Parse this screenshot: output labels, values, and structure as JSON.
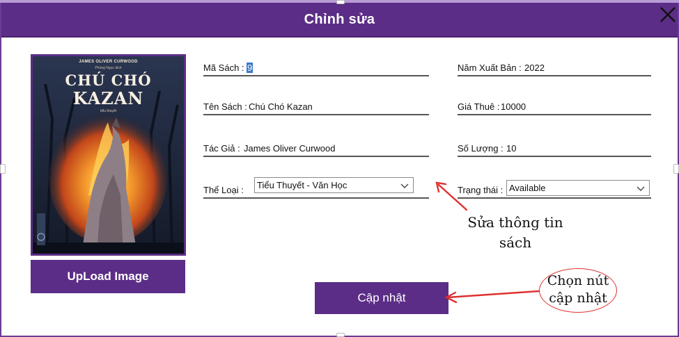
{
  "window": {
    "title": "Chỉnh sửa",
    "close_icon": "close-icon"
  },
  "cover": {
    "author_line": "JAMES OLIVER CURWOOD",
    "translator_line": "Phùng Ngọc dịch",
    "title_line1": "CHÚ CHÓ",
    "title_line2": "KAZAN",
    "subtitle": "tiểu thuyết"
  },
  "buttons": {
    "upload_label": "UpLoad Image",
    "update_label": "Cập nhật"
  },
  "fields": {
    "ma_sach": {
      "label": "Mã Sách :",
      "value": "9"
    },
    "ten_sach": {
      "label": "Tên Sách :",
      "value": "Chú Chó Kazan"
    },
    "tac_gia": {
      "label": "Tác Giả :",
      "value": "James Oliver Curwood"
    },
    "the_loai": {
      "label": "Thể  Loại :",
      "value": "Tiểu Thuyết - Văn Học"
    },
    "nam_xuat_ban": {
      "label": "Năm Xuất Bản :",
      "value": "2022"
    },
    "gia_thue": {
      "label": "Giá Thuê :",
      "value": "10000"
    },
    "so_luong": {
      "label": "Số Lượng :",
      "value": "10"
    },
    "trang_thai": {
      "label": "Trạng thái :",
      "value": "Available"
    }
  },
  "annotations": {
    "edit_line1": "Sửa thông tin",
    "edit_line2": "sách",
    "choose_line1": "Chọn nút",
    "choose_line2": "cập nhật"
  },
  "colors": {
    "accent": "#5b2d86",
    "annotation_red": "#e03030"
  }
}
